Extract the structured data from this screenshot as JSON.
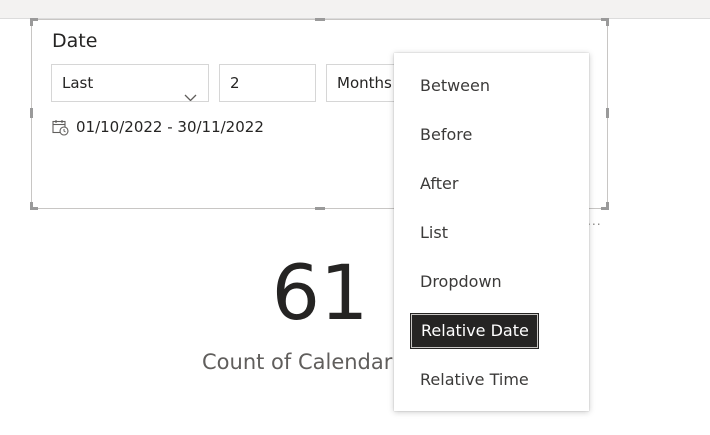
{
  "slicer": {
    "title": "Date",
    "direction_value": "Last",
    "number_value": "2",
    "unit_value": "Months",
    "date_range": "01/10/2022 - 30/11/2022"
  },
  "card": {
    "value": "61",
    "label": "Count of Calendar"
  },
  "menu": {
    "items": [
      {
        "label": "Between"
      },
      {
        "label": "Before"
      },
      {
        "label": "After"
      },
      {
        "label": "List"
      },
      {
        "label": "Dropdown"
      },
      {
        "label": "Relative Date",
        "selected": true
      },
      {
        "label": "Relative Time"
      }
    ]
  },
  "more_options": "...",
  "icons": {
    "dropdown": "chevron-down-icon",
    "calendar": "calendar-clock-icon"
  },
  "colors": {
    "text": "#252423",
    "selected_bg": "#252423",
    "selected_text": "#ffffff",
    "border": "#c8c6c4"
  }
}
